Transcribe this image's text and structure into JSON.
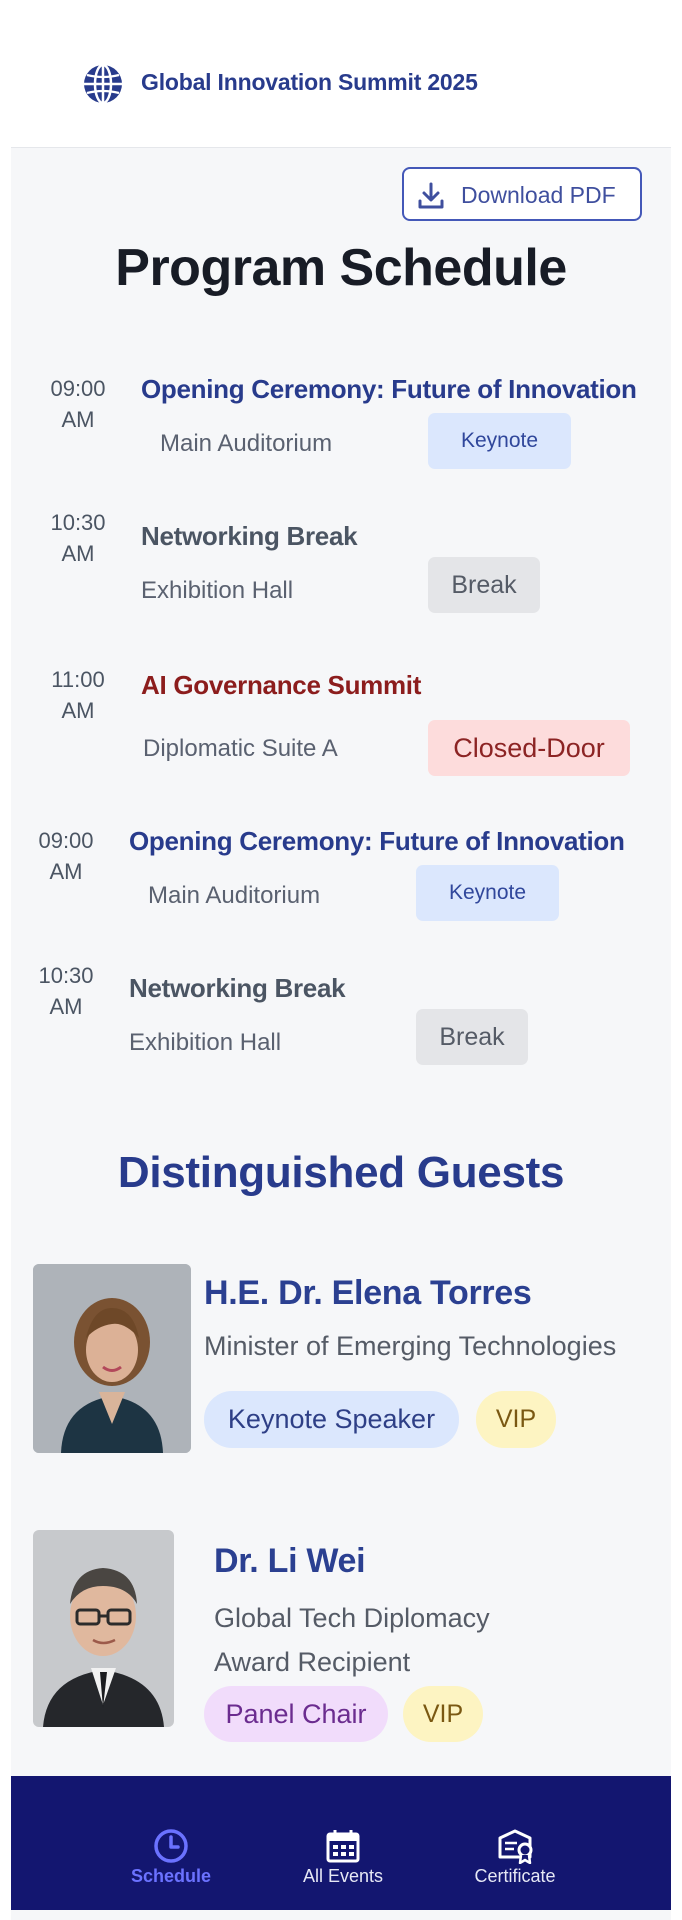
{
  "header": {
    "app_title": "Global Innovation Summit 2025",
    "logo_icon": "globe-icon"
  },
  "toolbar": {
    "download_label": "Download PDF",
    "download_icon": "download-icon"
  },
  "page": {
    "title": "Program Schedule"
  },
  "schedule": [
    {
      "time": "09:00 AM",
      "title": "Opening Ceremony: Future of Innovation",
      "location": "Main Auditorium",
      "tag": "Keynote",
      "title_color": "#283b8c"
    },
    {
      "time": "10:30 AM",
      "title": "Networking Break",
      "location": "Exhibition Hall",
      "tag": "Break",
      "title_color": "#4b5563"
    },
    {
      "time": "11:00 AM",
      "title": "AI Governance Summit",
      "location": "Diplomatic Suite A",
      "tag": "Closed-Door",
      "title_color": "#8c1d1d"
    },
    {
      "time": "09:00 AM",
      "title": "Opening Ceremony: Future of Innovation",
      "location": "Main Auditorium",
      "tag": "Keynote",
      "title_color": "#283b8c"
    },
    {
      "time": "10:30 AM",
      "title": "Networking Break",
      "location": "Exhibition Hall",
      "tag": "Break",
      "title_color": "#4b5563"
    }
  ],
  "guests": {
    "title": "Distinguished Guests",
    "items": [
      {
        "name": "H.E. Dr. Elena Torres",
        "role": "Minister of Emerging Technologies",
        "tags": [
          "Keynote Speaker",
          "VIP"
        ]
      },
      {
        "name": "Dr. Li Wei",
        "role": "Global Tech Diplomacy Award Recipient",
        "tags": [
          "Panel Chair",
          "VIP"
        ]
      }
    ]
  },
  "nav": {
    "items": [
      {
        "label": "Schedule",
        "icon": "clock-icon",
        "active": true
      },
      {
        "label": "All Events",
        "icon": "calendar-icon",
        "active": false
      },
      {
        "label": "Certificate",
        "icon": "certificate-icon",
        "active": false
      }
    ]
  },
  "colors": {
    "accent": "#283b8c",
    "nav_bg": "#131670",
    "nav_active": "#6b72ff"
  }
}
